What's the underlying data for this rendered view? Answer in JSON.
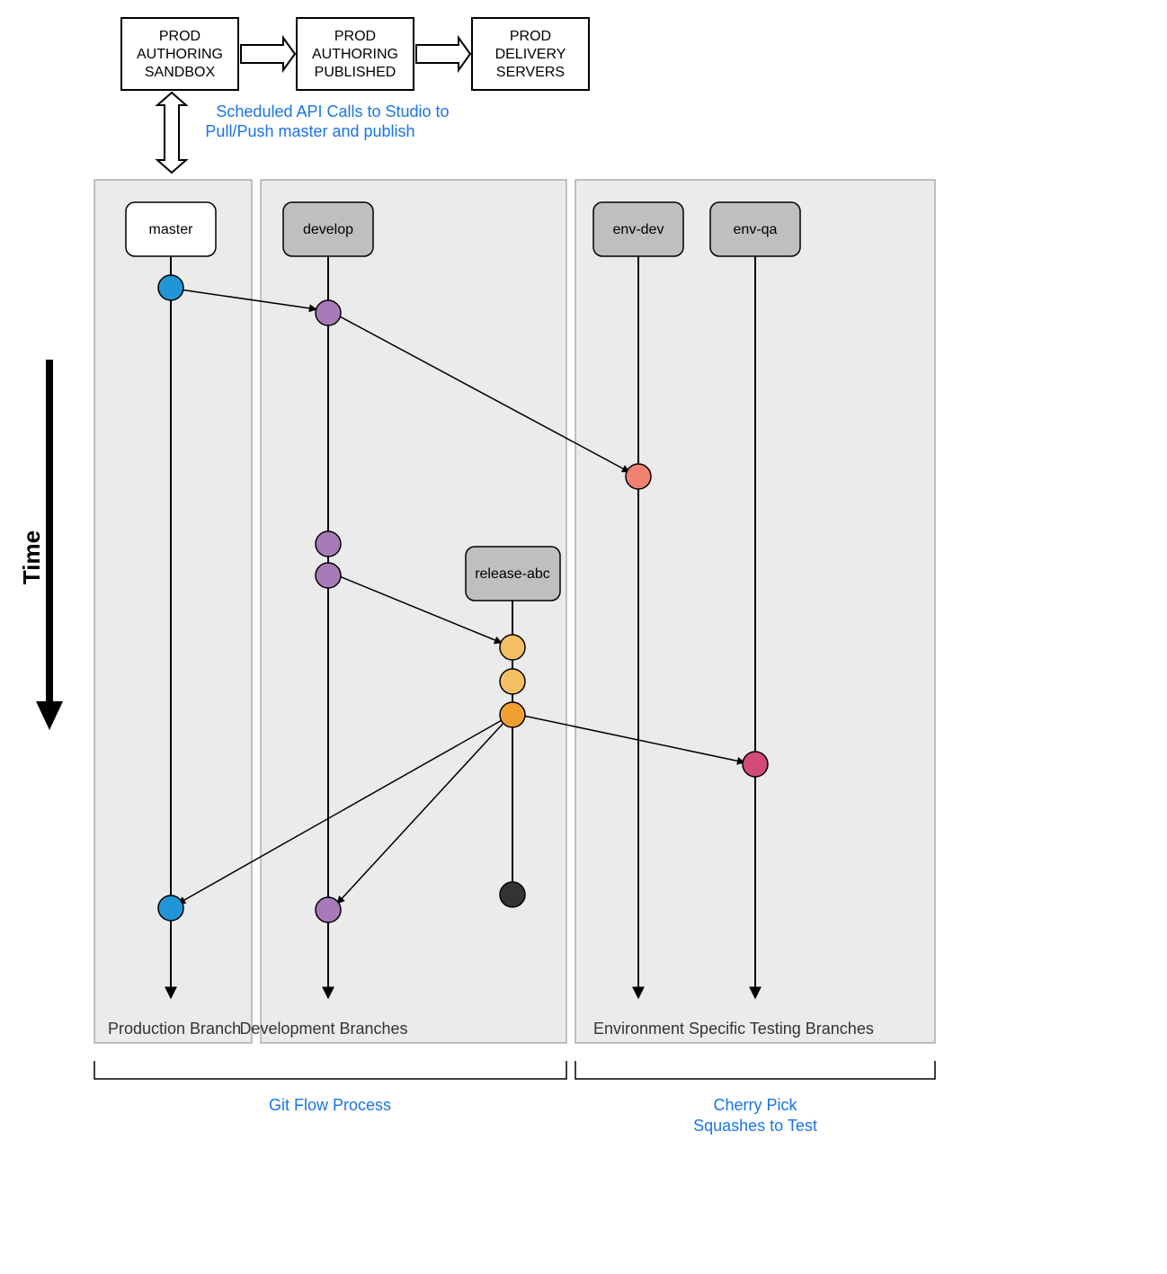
{
  "topBoxes": {
    "sandbox": {
      "l1": "PROD",
      "l2": "AUTHORING",
      "l3": "SANDBOX"
    },
    "published": {
      "l1": "PROD",
      "l2": "AUTHORING",
      "l3": "PUBLISHED"
    },
    "delivery": {
      "l1": "PROD",
      "l2": "DELIVERY",
      "l3": "SERVERS"
    }
  },
  "topCaption": {
    "l1": "Scheduled API Calls to Studio to",
    "l2": "Pull/Push master  and publish"
  },
  "branches": {
    "master": "master",
    "develop": "develop",
    "release": "release-abc",
    "envDev": "env-dev",
    "envQa": "env-qa"
  },
  "sections": {
    "prod": "Production Branch",
    "dev": "Development Branches",
    "env": "Environment Specific Testing Branches"
  },
  "bottom": {
    "gitflow": "Git Flow Process",
    "cherry": {
      "l1": "Cherry Pick",
      "l2": "Squashes to Test"
    }
  },
  "timeLabel": "Time",
  "colors": {
    "blue": "#2196d6",
    "purple": "#a87bb8",
    "orange": "#f0a030",
    "lightOrange": "#f5c063",
    "salmon": "#f08070",
    "pink": "#d14a7a",
    "black": "#333333",
    "grey": "#bfbfbf",
    "lightGrey": "#ebebeb",
    "stroke": "#000000"
  }
}
